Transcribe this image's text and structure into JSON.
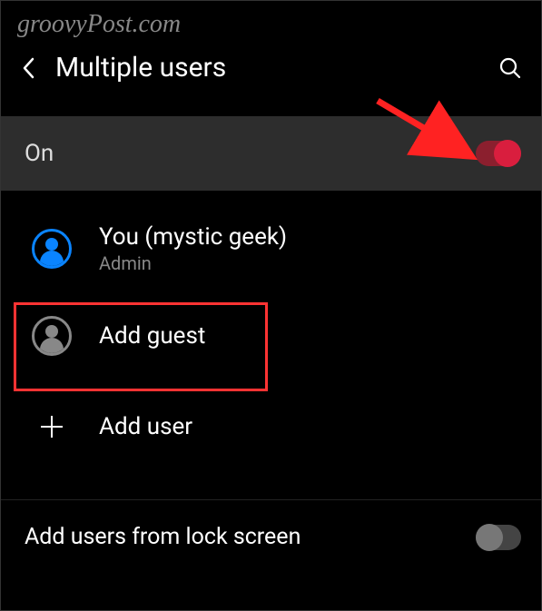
{
  "watermark": "groovyPost.com",
  "header": {
    "title": "Multiple users"
  },
  "main_toggle": {
    "label": "On",
    "state": true
  },
  "users": [
    {
      "label": "You (mystic geek)",
      "sublabel": "Admin",
      "icon": "person-blue"
    }
  ],
  "actions": {
    "add_guest": "Add guest",
    "add_user": "Add user"
  },
  "lock_screen": {
    "label": "Add users from lock screen",
    "state": false
  },
  "annotations": {
    "highlight": "add-guest-row",
    "arrow_target": "main-toggle"
  }
}
